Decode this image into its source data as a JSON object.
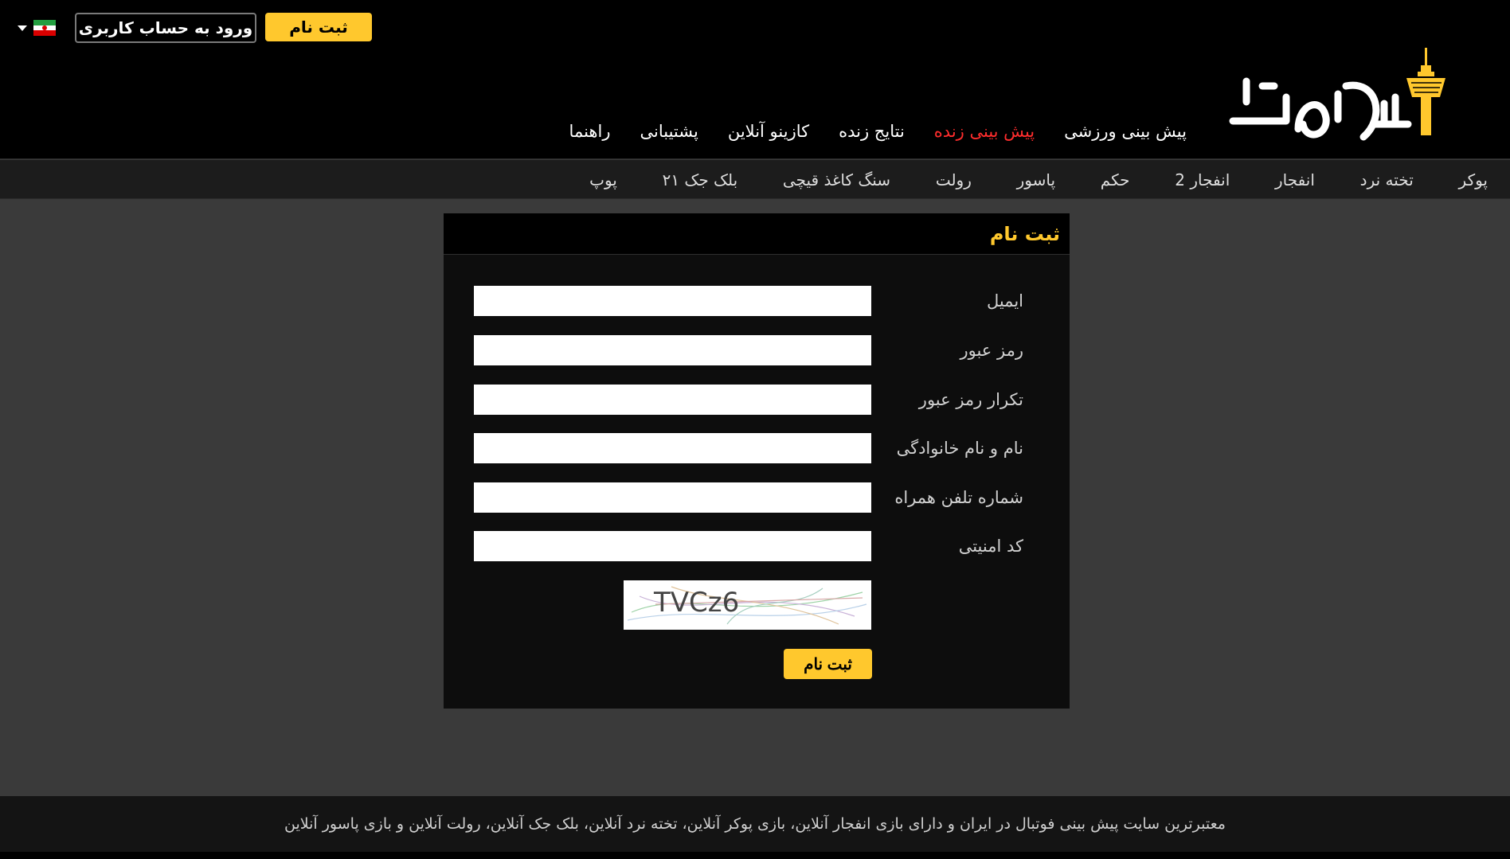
{
  "header": {
    "register_label": "ثبت نام",
    "login_label": "ورود به حساب کاربری",
    "language_flag": "iran-flag-icon",
    "nav": [
      {
        "label": "پیش بینی ورزشی",
        "active": false
      },
      {
        "label": "پیش بینی زنده",
        "active": true
      },
      {
        "label": "نتایج زنده",
        "active": false
      },
      {
        "label": "کازینو آنلاین",
        "active": false
      },
      {
        "label": "پشتیبانی",
        "active": false
      },
      {
        "label": "راهنما",
        "active": false
      }
    ]
  },
  "subnav": [
    "پوکر",
    "تخته نرد",
    "انفجار",
    "انفجار 2",
    "حکم",
    "پاسور",
    "رولت",
    "سنگ کاغذ قیچی",
    "بلک جک ۲۱",
    "پوپ"
  ],
  "form": {
    "title": "ثبت نام",
    "fields": [
      {
        "label": "ایمیل",
        "value": ""
      },
      {
        "label": "رمز عبور",
        "value": ""
      },
      {
        "label": "تکرار رمز عبور",
        "value": ""
      },
      {
        "label": "نام و نام خانوادگی",
        "value": ""
      },
      {
        "label": "شماره تلفن همراه",
        "value": ""
      },
      {
        "label": "کد امنیتی",
        "value": ""
      }
    ],
    "captcha_text": "TVCz6",
    "submit_label": "ثبت نام"
  },
  "footer": {
    "text": "معتبرترین سایت پیش بینی فوتبال در ایران و دارای بازی انفجار آنلاین، بازی پوکر آنلاین، تخته نرد آنلاین، بلک جک آنلاین، رولت آنلاین و بازی پاسور آنلاین"
  },
  "colors": {
    "accent": "#ffc82d",
    "active_nav": "#ff2d2d",
    "header_bg": "#000000",
    "page_bg": "#3a3a3a"
  }
}
